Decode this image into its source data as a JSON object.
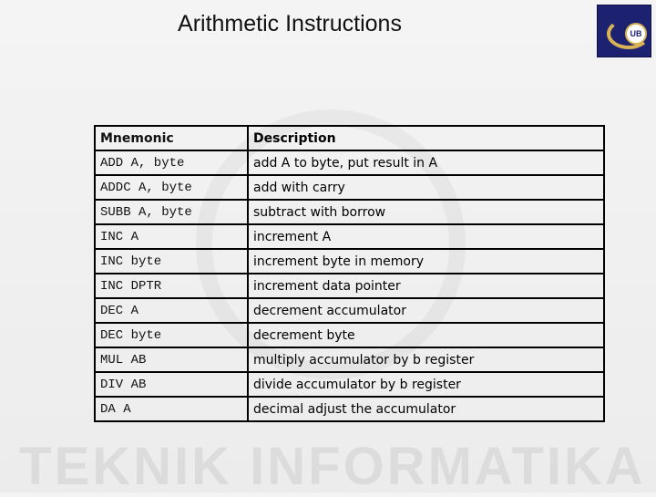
{
  "title": "Arithmetic Instructions",
  "footer": "TEKNIK INFORMATIKA",
  "logo_text": "UB",
  "headers": [
    "Mnemonic",
    "Description"
  ],
  "rows": [
    [
      "ADD A, byte",
      "add A to byte, put result in A"
    ],
    [
      "ADDC A, byte",
      "add with carry"
    ],
    [
      "SUBB A, byte",
      "subtract with borrow"
    ],
    [
      "INC A",
      "increment A"
    ],
    [
      "INC byte",
      "increment byte in memory"
    ],
    [
      "INC DPTR",
      "increment data pointer"
    ],
    [
      "DEC A",
      "decrement accumulator"
    ],
    [
      "DEC byte",
      "decrement byte"
    ],
    [
      "MUL AB",
      "multiply accumulator by b register"
    ],
    [
      "DIV AB",
      "divide accumulator by b register"
    ],
    [
      "DA A",
      "decimal adjust the accumulator"
    ]
  ]
}
